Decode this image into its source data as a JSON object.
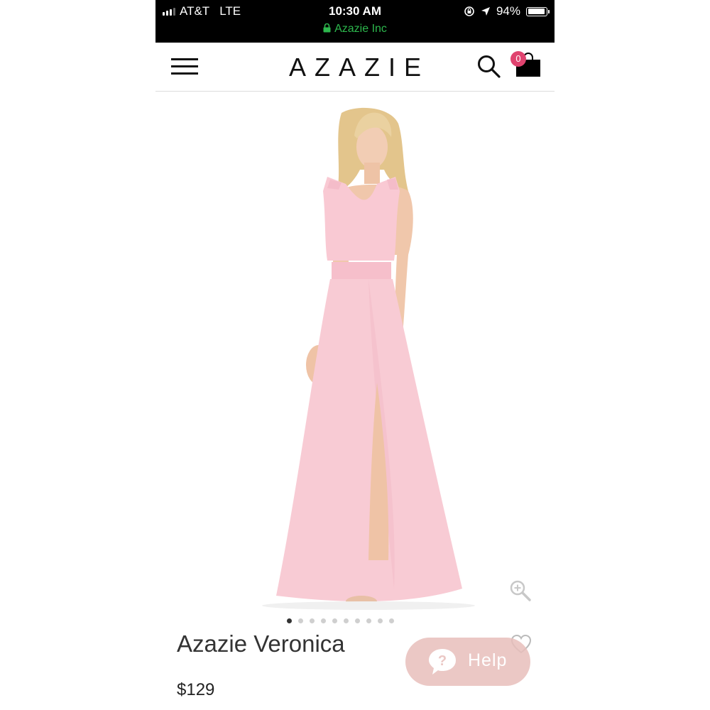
{
  "status_bar": {
    "carrier": "AT&T",
    "network": "LTE",
    "time": "10:30 AM",
    "site": "Azazie Inc",
    "battery_percent": "94%",
    "battery_level": 0.94
  },
  "header": {
    "logo": "AZAZIE",
    "cart_count": "0"
  },
  "gallery": {
    "image_count": 10,
    "active_index": 0
  },
  "product": {
    "name": "Azazie Veronica",
    "price": "$129"
  },
  "help": {
    "label": "Help"
  },
  "icons": {
    "menu": "hamburger-menu-icon",
    "search": "search-icon",
    "cart": "shopping-bag-icon",
    "zoom": "zoom-in-icon",
    "wishlist": "heart-icon",
    "help": "question-bubble-icon",
    "lock": "lock-icon",
    "location": "location-arrow-icon",
    "rotation": "rotation-lock-icon"
  },
  "colors": {
    "badge": "#e0436f",
    "secure_url": "#2db84d",
    "help_button": "#e8bfbc",
    "dress": "#f7c8d0"
  }
}
